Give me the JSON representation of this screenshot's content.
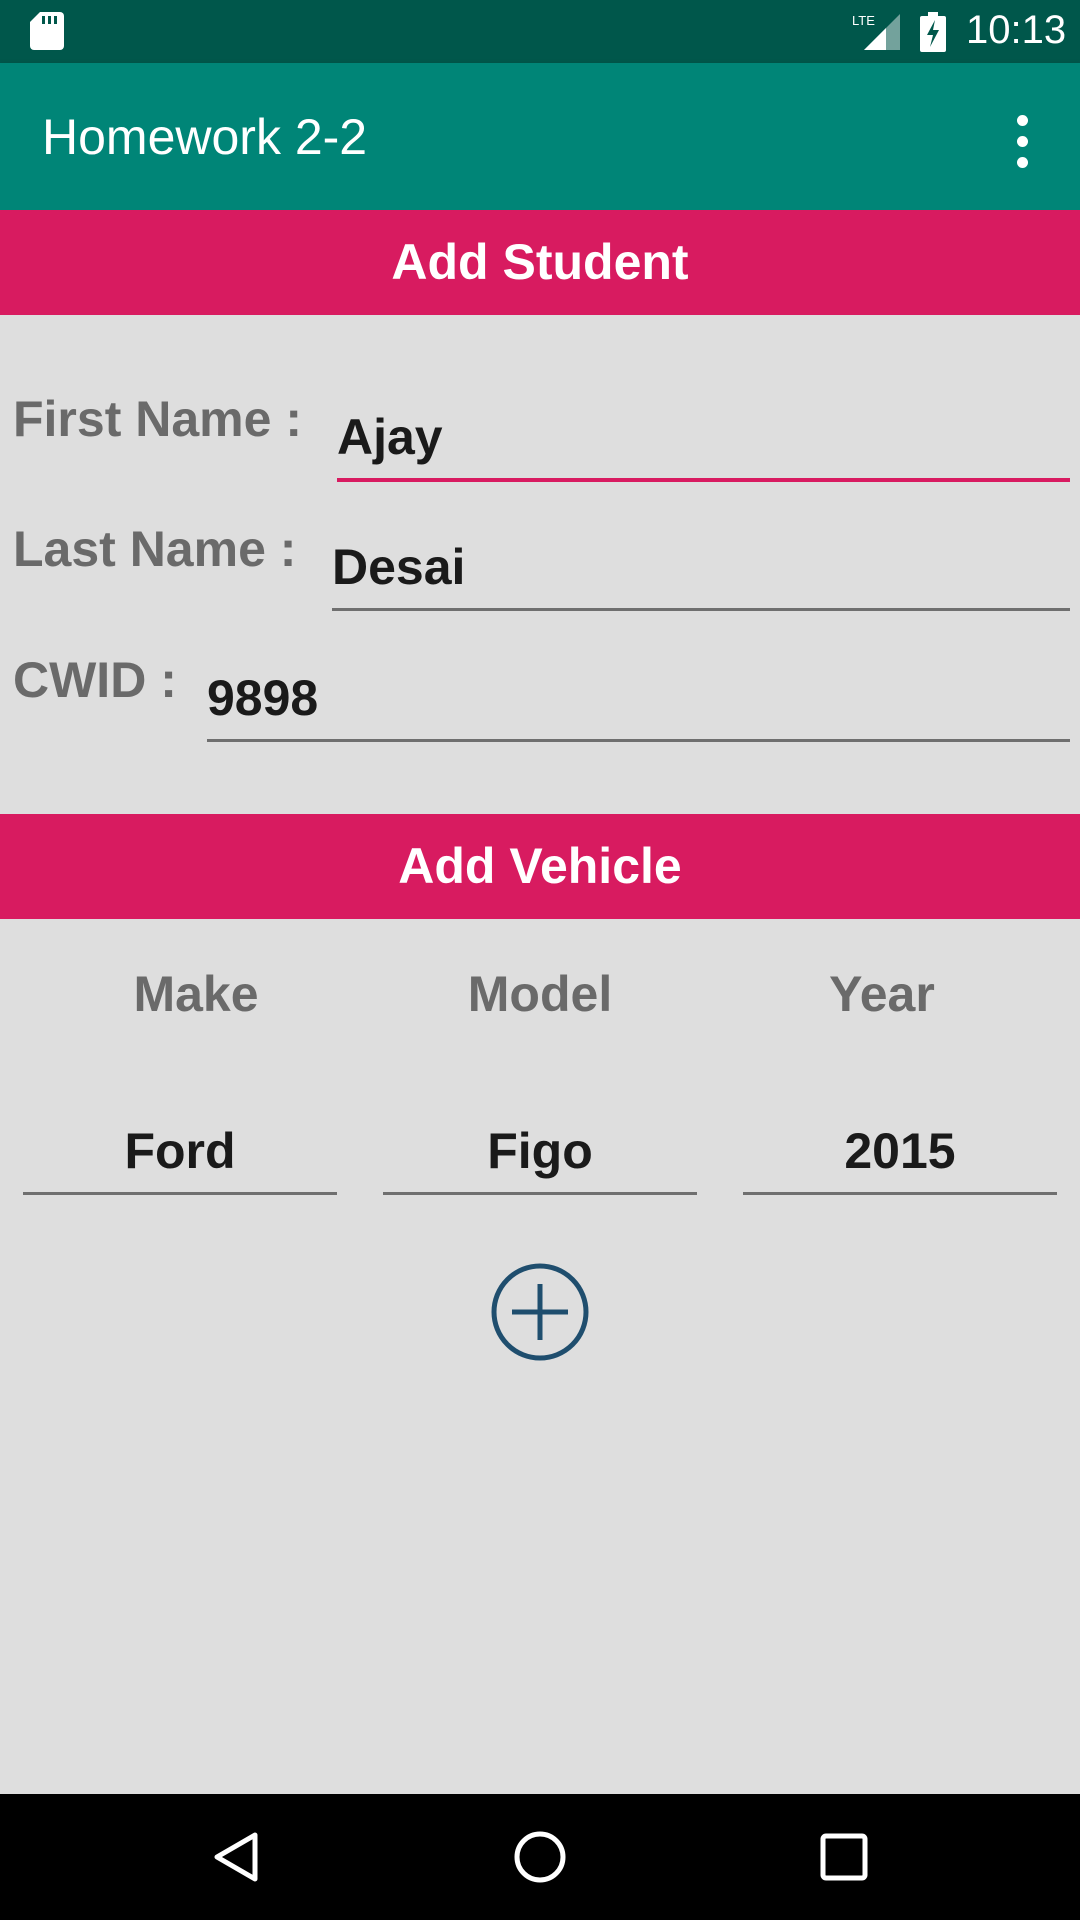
{
  "status_bar": {
    "time": "10:13",
    "icons": [
      "sd-card-icon",
      "lte-signal-icon",
      "battery-charging-icon"
    ]
  },
  "app_bar": {
    "title": "Homework 2-2",
    "overflow_icon": "more-vert-icon"
  },
  "student_section": {
    "header": "Add Student",
    "first_name_label": "First Name :",
    "first_name_value": "Ajay",
    "last_name_label": "Last Name :",
    "last_name_value": "Desai",
    "cwid_label": "CWID :",
    "cwid_value": "9898"
  },
  "vehicle_section": {
    "header": "Add Vehicle",
    "columns": [
      "Make",
      "Model",
      "Year"
    ],
    "make_value": "Ford",
    "model_value": "Figo",
    "year_value": "2015",
    "add_icon": "add-circle-icon"
  },
  "nav_bar": {
    "buttons": [
      "back-icon",
      "home-icon",
      "recents-icon"
    ]
  },
  "colors": {
    "status_bar": "#00574b",
    "app_bar": "#008577",
    "accent": "#d81b60",
    "background": "#dedede",
    "add_icon": "#1f4e6e"
  }
}
